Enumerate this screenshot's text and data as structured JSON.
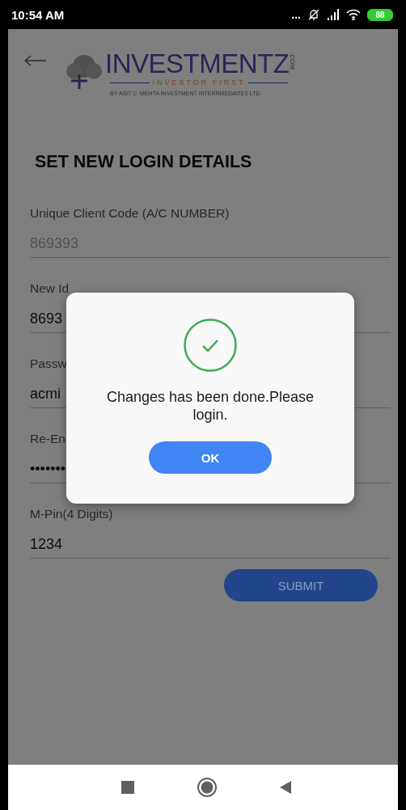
{
  "status_bar": {
    "time": "10:54 AM",
    "dots": "...",
    "battery": "88"
  },
  "header": {
    "brand": "INVESTMENTZ",
    "domain": ".COM",
    "tagline": "INVESTOR FIRST",
    "byline": "BY ASIT C. MEHTA INVESTMENT INTERRMEDIATES LTD."
  },
  "title": "SET NEW LOGIN DETAILS",
  "fields": [
    {
      "label": "Unique Client Code (A/C NUMBER)",
      "value": "869393",
      "disabled": true
    },
    {
      "label": "New Id",
      "value": "8693",
      "disabled": false
    },
    {
      "label": "Passw",
      "value": "acmi",
      "disabled": false
    },
    {
      "label": "Re-En",
      "value": "•••••••",
      "disabled": false
    },
    {
      "label": "M-Pin(4 Digits)",
      "value": "1234",
      "disabled": false
    }
  ],
  "submit_button": "SUBMIT",
  "dialog": {
    "message": "Changes has been done.Please login.",
    "button": "OK"
  }
}
